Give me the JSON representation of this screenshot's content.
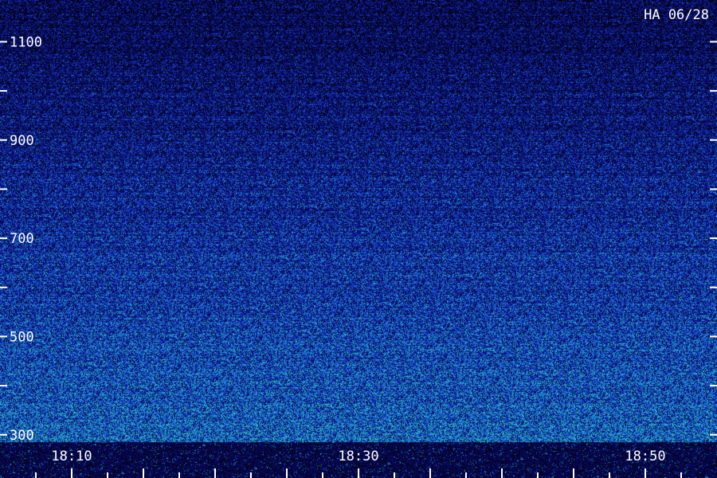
{
  "title": "HA 06/28",
  "chart_data": {
    "type": "heatmap",
    "title": "HA 06/28",
    "xlabel": "",
    "ylabel": "",
    "x_range": [
      "18:05",
      "18:55"
    ],
    "y_range": [
      285,
      1185
    ],
    "x_tick_labels": [
      "18:10",
      "18:30",
      "18:50"
    ],
    "x_ticks_labeled": [
      "18:10",
      "18:30",
      "18:50"
    ],
    "y_tick_labels": [
      "1100",
      "900",
      "700",
      "500",
      "300"
    ],
    "y_ticks_labeled": [
      1100,
      900,
      700,
      500,
      300
    ],
    "colormap": [
      "#000000",
      "#0a0a6e",
      "#1428c8",
      "#1e8cdc",
      "#28c8b4",
      "#3cf06e"
    ],
    "intensity_trend": "noise intensity increases toward lower frequencies; brighter band near bottom edge",
    "colors": {
      "background": "#0a0a50",
      "text": "#ffffff"
    }
  }
}
